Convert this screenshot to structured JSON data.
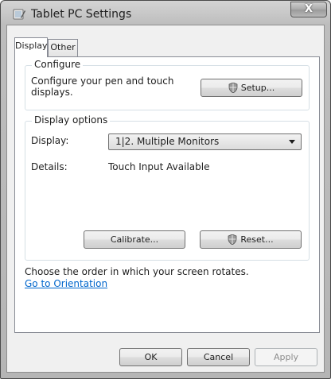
{
  "window": {
    "title": "Tablet PC Settings",
    "close_label": "X"
  },
  "tabs": [
    {
      "label": "Display",
      "selected": true
    },
    {
      "label": "Other",
      "selected": false
    }
  ],
  "configure": {
    "group_label": "Configure",
    "description": "Configure your pen and touch displays.",
    "setup_label": "Setup..."
  },
  "display_options": {
    "group_label": "Display options",
    "display_label": "Display:",
    "display_value": "1|2. Multiple Monitors",
    "details_label": "Details:",
    "details_value": "Touch Input Available",
    "calibrate_label": "Calibrate...",
    "reset_label": "Reset..."
  },
  "orientation": {
    "text": "Choose the order in which your screen rotates.",
    "link": "Go to Orientation"
  },
  "footer": {
    "ok_label": "OK",
    "cancel_label": "Cancel",
    "apply_label": "Apply"
  },
  "colors": {
    "link": "#0066cc",
    "default_button_border": "#3c7fb1"
  }
}
